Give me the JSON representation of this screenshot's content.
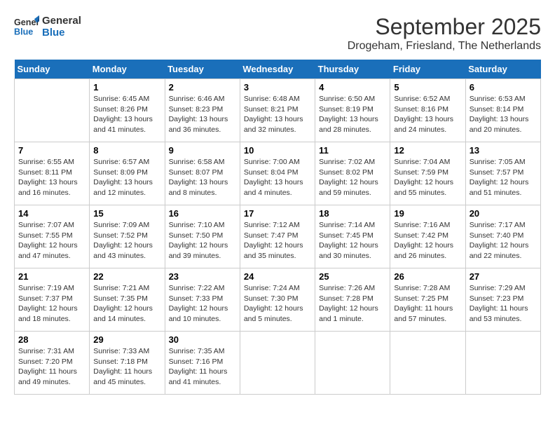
{
  "header": {
    "logo_line1": "General",
    "logo_line2": "Blue",
    "month": "September 2025",
    "location": "Drogeham, Friesland, The Netherlands"
  },
  "days_of_week": [
    "Sunday",
    "Monday",
    "Tuesday",
    "Wednesday",
    "Thursday",
    "Friday",
    "Saturday"
  ],
  "weeks": [
    [
      {
        "day": "",
        "info": ""
      },
      {
        "day": "1",
        "info": "Sunrise: 6:45 AM\nSunset: 8:26 PM\nDaylight: 13 hours\nand 41 minutes."
      },
      {
        "day": "2",
        "info": "Sunrise: 6:46 AM\nSunset: 8:23 PM\nDaylight: 13 hours\nand 36 minutes."
      },
      {
        "day": "3",
        "info": "Sunrise: 6:48 AM\nSunset: 8:21 PM\nDaylight: 13 hours\nand 32 minutes."
      },
      {
        "day": "4",
        "info": "Sunrise: 6:50 AM\nSunset: 8:19 PM\nDaylight: 13 hours\nand 28 minutes."
      },
      {
        "day": "5",
        "info": "Sunrise: 6:52 AM\nSunset: 8:16 PM\nDaylight: 13 hours\nand 24 minutes."
      },
      {
        "day": "6",
        "info": "Sunrise: 6:53 AM\nSunset: 8:14 PM\nDaylight: 13 hours\nand 20 minutes."
      }
    ],
    [
      {
        "day": "7",
        "info": "Sunrise: 6:55 AM\nSunset: 8:11 PM\nDaylight: 13 hours\nand 16 minutes."
      },
      {
        "day": "8",
        "info": "Sunrise: 6:57 AM\nSunset: 8:09 PM\nDaylight: 13 hours\nand 12 minutes."
      },
      {
        "day": "9",
        "info": "Sunrise: 6:58 AM\nSunset: 8:07 PM\nDaylight: 13 hours\nand 8 minutes."
      },
      {
        "day": "10",
        "info": "Sunrise: 7:00 AM\nSunset: 8:04 PM\nDaylight: 13 hours\nand 4 minutes."
      },
      {
        "day": "11",
        "info": "Sunrise: 7:02 AM\nSunset: 8:02 PM\nDaylight: 12 hours\nand 59 minutes."
      },
      {
        "day": "12",
        "info": "Sunrise: 7:04 AM\nSunset: 7:59 PM\nDaylight: 12 hours\nand 55 minutes."
      },
      {
        "day": "13",
        "info": "Sunrise: 7:05 AM\nSunset: 7:57 PM\nDaylight: 12 hours\nand 51 minutes."
      }
    ],
    [
      {
        "day": "14",
        "info": "Sunrise: 7:07 AM\nSunset: 7:55 PM\nDaylight: 12 hours\nand 47 minutes."
      },
      {
        "day": "15",
        "info": "Sunrise: 7:09 AM\nSunset: 7:52 PM\nDaylight: 12 hours\nand 43 minutes."
      },
      {
        "day": "16",
        "info": "Sunrise: 7:10 AM\nSunset: 7:50 PM\nDaylight: 12 hours\nand 39 minutes."
      },
      {
        "day": "17",
        "info": "Sunrise: 7:12 AM\nSunset: 7:47 PM\nDaylight: 12 hours\nand 35 minutes."
      },
      {
        "day": "18",
        "info": "Sunrise: 7:14 AM\nSunset: 7:45 PM\nDaylight: 12 hours\nand 30 minutes."
      },
      {
        "day": "19",
        "info": "Sunrise: 7:16 AM\nSunset: 7:42 PM\nDaylight: 12 hours\nand 26 minutes."
      },
      {
        "day": "20",
        "info": "Sunrise: 7:17 AM\nSunset: 7:40 PM\nDaylight: 12 hours\nand 22 minutes."
      }
    ],
    [
      {
        "day": "21",
        "info": "Sunrise: 7:19 AM\nSunset: 7:37 PM\nDaylight: 12 hours\nand 18 minutes."
      },
      {
        "day": "22",
        "info": "Sunrise: 7:21 AM\nSunset: 7:35 PM\nDaylight: 12 hours\nand 14 minutes."
      },
      {
        "day": "23",
        "info": "Sunrise: 7:22 AM\nSunset: 7:33 PM\nDaylight: 12 hours\nand 10 minutes."
      },
      {
        "day": "24",
        "info": "Sunrise: 7:24 AM\nSunset: 7:30 PM\nDaylight: 12 hours\nand 5 minutes."
      },
      {
        "day": "25",
        "info": "Sunrise: 7:26 AM\nSunset: 7:28 PM\nDaylight: 12 hours\nand 1 minute."
      },
      {
        "day": "26",
        "info": "Sunrise: 7:28 AM\nSunset: 7:25 PM\nDaylight: 11 hours\nand 57 minutes."
      },
      {
        "day": "27",
        "info": "Sunrise: 7:29 AM\nSunset: 7:23 PM\nDaylight: 11 hours\nand 53 minutes."
      }
    ],
    [
      {
        "day": "28",
        "info": "Sunrise: 7:31 AM\nSunset: 7:20 PM\nDaylight: 11 hours\nand 49 minutes."
      },
      {
        "day": "29",
        "info": "Sunrise: 7:33 AM\nSunset: 7:18 PM\nDaylight: 11 hours\nand 45 minutes."
      },
      {
        "day": "30",
        "info": "Sunrise: 7:35 AM\nSunset: 7:16 PM\nDaylight: 11 hours\nand 41 minutes."
      },
      {
        "day": "",
        "info": ""
      },
      {
        "day": "",
        "info": ""
      },
      {
        "day": "",
        "info": ""
      },
      {
        "day": "",
        "info": ""
      }
    ]
  ]
}
